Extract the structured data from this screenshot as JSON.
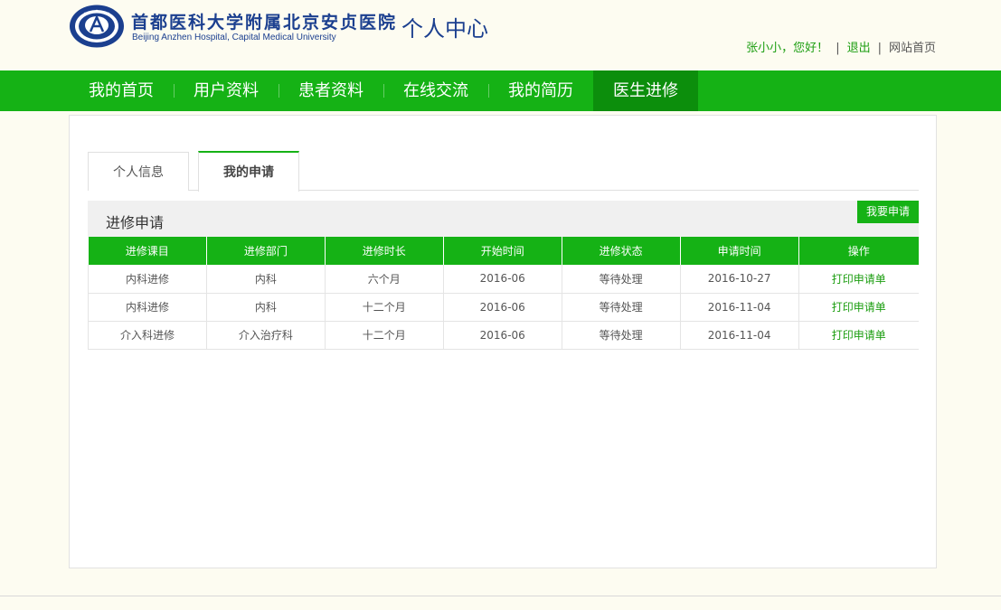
{
  "header": {
    "hospital_name_cn": "首都医科大学附属北京安贞医院",
    "hospital_name_en": "Beijing Anzhen Hospital, Capital Medical University",
    "page_title": "个人中心",
    "greeting": "张小小，您好！",
    "logout_label": "退出",
    "site_home_label": "网站首页",
    "separator": "|"
  },
  "nav": {
    "items": [
      {
        "label": "我的首页"
      },
      {
        "label": "用户资料"
      },
      {
        "label": "患者资料"
      },
      {
        "label": "在线交流"
      },
      {
        "label": "我的简历"
      },
      {
        "label": "医生进修"
      }
    ],
    "active_index": 5
  },
  "tabs": [
    {
      "label": "个人信息"
    },
    {
      "label": "我的申请"
    }
  ],
  "section": {
    "title": "进修申请",
    "apply_button": "我要申请"
  },
  "table": {
    "headers": [
      "进修课目",
      "进修部门",
      "进修时长",
      "开始时间",
      "进修状态",
      "申请时间",
      "操作"
    ],
    "rows": [
      [
        "内科进修",
        "内科",
        "六个月",
        "2016-06",
        "等待处理",
        "2016-10-27",
        "打印申请单"
      ],
      [
        "内科进修",
        "内科",
        "十二个月",
        "2016-06",
        "等待处理",
        "2016-11-04",
        "打印申请单"
      ],
      [
        "介入科进修",
        "介入治疗科",
        "十二个月",
        "2016-06",
        "等待处理",
        "2016-11-04",
        "打印申请单"
      ]
    ]
  },
  "colors": {
    "primary_green": "#15b215",
    "active_nav_green": "#0c8e0c",
    "link_green": "#1d9e12",
    "brand_blue": "#1b3f8f",
    "page_bg": "#fdfcf1"
  },
  "icons": {
    "logo": "hospital-emblem-icon"
  }
}
